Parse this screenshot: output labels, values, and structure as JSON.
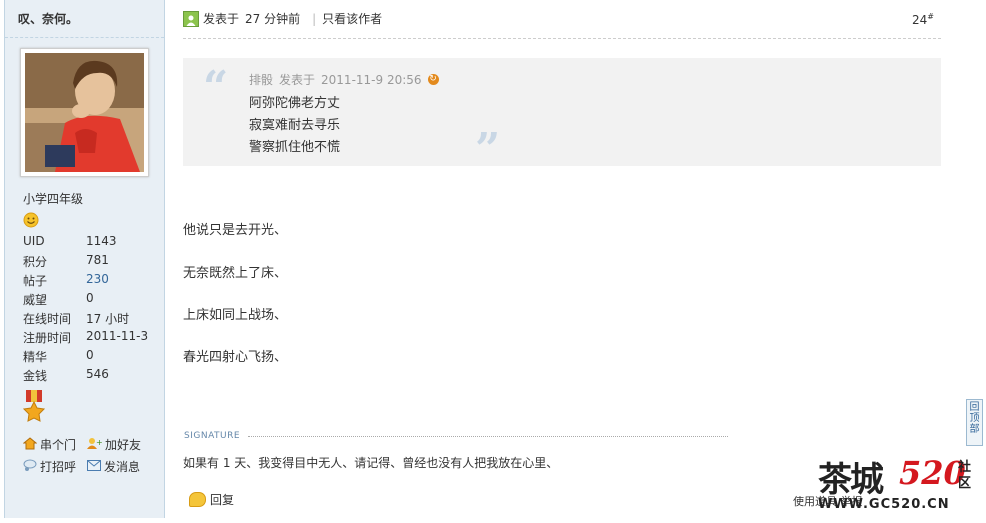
{
  "author": {
    "name": "叹、奈何。",
    "group": "小学四年级",
    "stats": [
      {
        "key": "UID",
        "value": "1143",
        "link": false
      },
      {
        "key": "积分",
        "value": "781",
        "link": false
      },
      {
        "key": "帖子",
        "value": "230",
        "link": true
      },
      {
        "key": "威望",
        "value": "0",
        "link": false
      },
      {
        "key": "在线时间",
        "value": "17 小时",
        "link": false
      },
      {
        "key": "注册时间",
        "value": "2011-11-3",
        "link": false
      },
      {
        "key": "精华",
        "value": "0",
        "link": false
      },
      {
        "key": "金钱",
        "value": "546",
        "link": false
      }
    ],
    "actions": {
      "visit": "串个门",
      "add_friend": "加好友",
      "poke": "打招呼",
      "message": "发消息"
    }
  },
  "post": {
    "posted_label": "发表于",
    "posted_time": "27 分钟前",
    "author_only": "只看该作者",
    "floor": "24",
    "floor_mark": "#",
    "quote": {
      "author": "排骰",
      "posted_label": "发表于",
      "time": "2011-11-9 20:56",
      "lines": [
        "阿弥陀佛老方丈",
        "寂寞难耐去寻乐",
        "警察抓住他不慌"
      ]
    },
    "body": [
      "他说只是去开光、",
      "无奈既然上了床、",
      "上床如同上战场、",
      "春光四射心飞扬、"
    ],
    "signature_label": "SIGNATURE",
    "signature": "如果有 1 天、我变得目中无人、请记得、曾经也没有人把我放在心里、",
    "reply": "回复",
    "help_text": "使用道具  举报"
  },
  "back_to_top": "回顶部",
  "watermark": {
    "brand": "茶城",
    "number": "520",
    "suffix": "社区",
    "url": "WWW.GC520.CN"
  }
}
